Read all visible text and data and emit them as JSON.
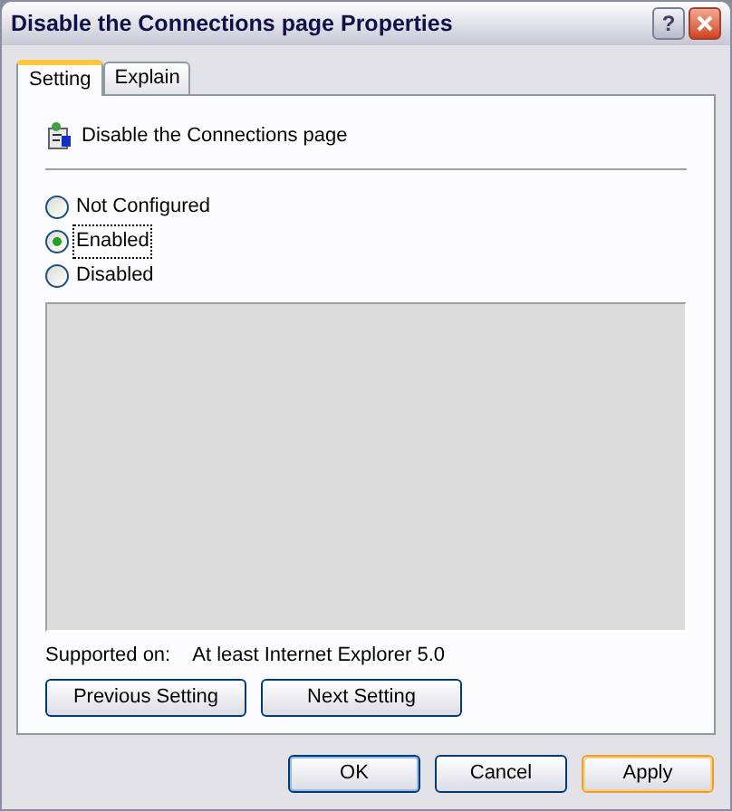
{
  "window": {
    "title": "Disable the Connections page Properties"
  },
  "title_buttons": [
    {
      "kind": "help",
      "label": "?"
    },
    {
      "kind": "close"
    }
  ],
  "tabs": [
    {
      "label": "Setting",
      "selected": true
    },
    {
      "label": "Explain",
      "selected": false
    }
  ],
  "policy": {
    "name": "Disable the Connections page"
  },
  "options": [
    {
      "label": "Not Configured",
      "selected": false,
      "focused": false
    },
    {
      "label": "Enabled",
      "selected": true,
      "focused": true
    },
    {
      "label": "Disabled",
      "selected": false,
      "focused": false
    }
  ],
  "supported": {
    "label": "Supported on:",
    "value": "At least Internet Explorer 5.0"
  },
  "nav_buttons": [
    {
      "label": "Previous Setting"
    },
    {
      "label": "Next Setting"
    }
  ],
  "buttons": [
    {
      "label": "OK",
      "hot": false,
      "default": true
    },
    {
      "label": "Cancel",
      "hot": false,
      "default": false
    },
    {
      "label": "Apply",
      "hot": true,
      "default": false
    }
  ]
}
